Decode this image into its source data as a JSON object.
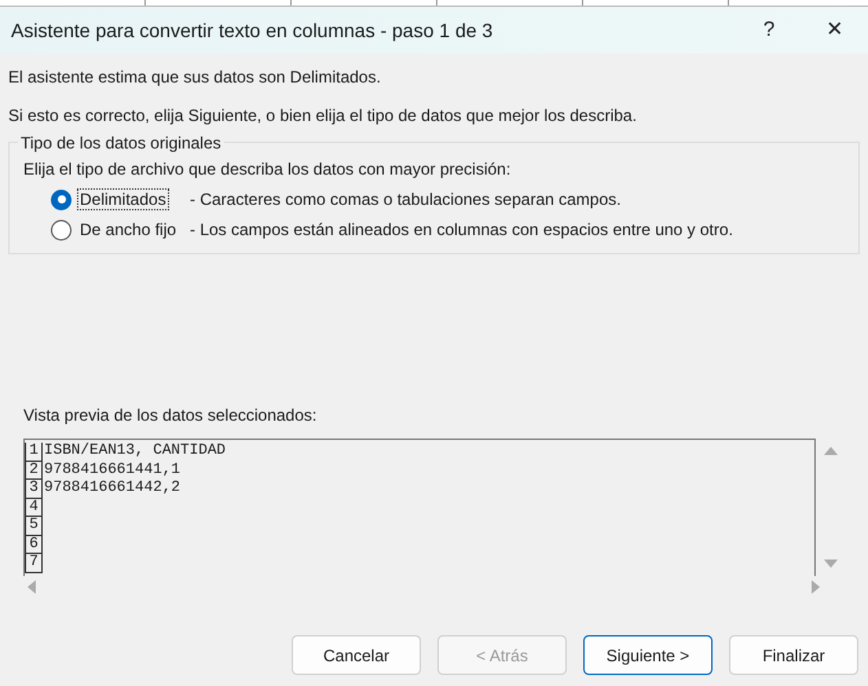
{
  "window": {
    "title": "Asistente para convertir texto en columnas - paso 1 de 3",
    "help": "?",
    "close": "✕"
  },
  "intro": [
    "El asistente estima que sus datos son Delimitados.",
    "Si esto es correcto, elija Siguiente, o bien elija el tipo de datos que mejor los describa."
  ],
  "group": {
    "title": "Tipo de los datos originales",
    "prompt": "Elija el tipo de archivo que describa los datos con mayor precisión:",
    "options": [
      {
        "label": "Delimitados",
        "description": "- Caracteres como comas o tabulaciones separan campos.",
        "selected": true,
        "focused": true
      },
      {
        "label": "De ancho fijo",
        "description": "- Los campos están alineados en columnas con espacios entre uno y otro.",
        "selected": false,
        "focused": false
      }
    ]
  },
  "preview": {
    "label": "Vista previa de los datos seleccionados:",
    "rows": [
      {
        "number": "1",
        "text": "ISBN/EAN13, CANTIDAD"
      },
      {
        "number": "2",
        "text": "9788416661441,1"
      },
      {
        "number": "3",
        "text": "9788416661442,2"
      },
      {
        "number": "4",
        "text": ""
      },
      {
        "number": "5",
        "text": ""
      },
      {
        "number": "6",
        "text": ""
      },
      {
        "number": "7",
        "text": ""
      }
    ]
  },
  "buttons": [
    {
      "label": "Cancelar",
      "disabled": false,
      "default": false
    },
    {
      "label": "< Atrás",
      "disabled": true,
      "default": false
    },
    {
      "label": "Siguiente >",
      "disabled": false,
      "default": true
    },
    {
      "label": "Finalizar",
      "disabled": false,
      "default": false
    }
  ]
}
